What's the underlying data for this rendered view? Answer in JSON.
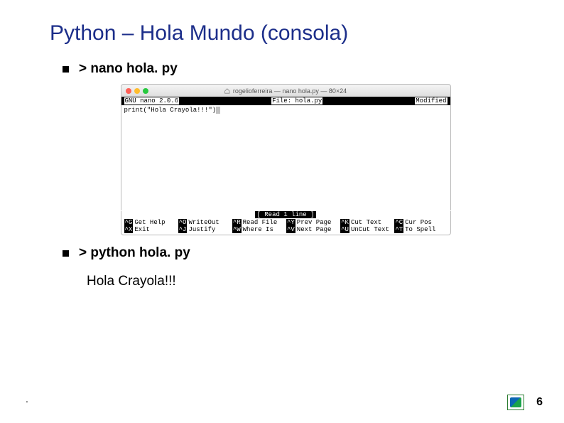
{
  "title": "Python – Hola Mundo (consola)",
  "bullets": {
    "nano": "> nano hola. py",
    "python": "> python hola. py"
  },
  "terminal": {
    "window_title": "rogelioferreira — nano hola.py — 80×24",
    "nano_version": "GNU nano 2.0.6",
    "file_label": "File: hola.py",
    "status": "Modified",
    "code": "print(\"Hola Crayola!!!\")",
    "read_line": "[ Read 1 line ]",
    "shortcuts_row1": [
      {
        "key": "^G",
        "label": "Get Help"
      },
      {
        "key": "^O",
        "label": "WriteOut"
      },
      {
        "key": "^R",
        "label": "Read File"
      },
      {
        "key": "^Y",
        "label": "Prev Page"
      },
      {
        "key": "^K",
        "label": "Cut Text"
      },
      {
        "key": "^C",
        "label": "Cur Pos"
      }
    ],
    "shortcuts_row2": [
      {
        "key": "^X",
        "label": "Exit"
      },
      {
        "key": "^J",
        "label": "Justify"
      },
      {
        "key": "^W",
        "label": "Where Is"
      },
      {
        "key": "^V",
        "label": "Next Page"
      },
      {
        "key": "^U",
        "label": "UnCut Text"
      },
      {
        "key": "^T",
        "label": "To Spell"
      }
    ]
  },
  "output": "Hola Crayola!!!",
  "page_number": "6",
  "dot": "."
}
